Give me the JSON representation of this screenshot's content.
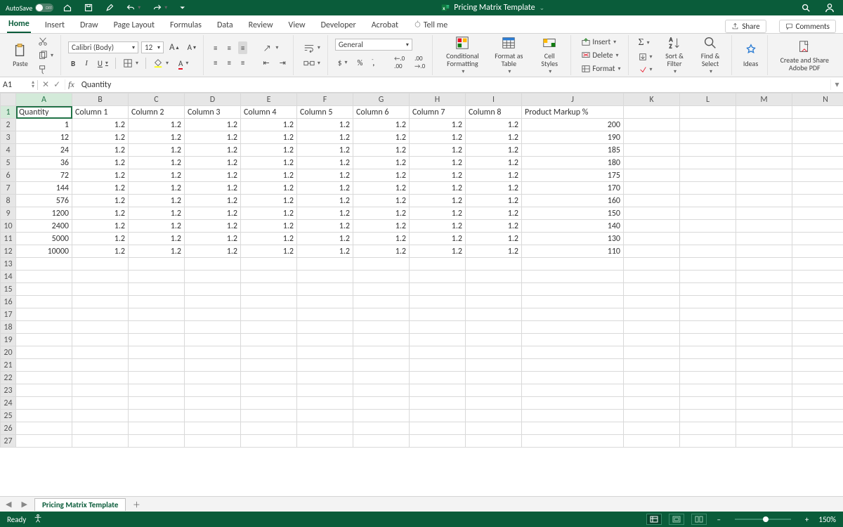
{
  "titlebar": {
    "autosave_label": "AutoSave",
    "document_title": "Pricing Matrix Template"
  },
  "tabs": {
    "items": [
      "Home",
      "Insert",
      "Draw",
      "Page Layout",
      "Formulas",
      "Data",
      "Review",
      "View",
      "Developer",
      "Acrobat"
    ],
    "tellme": "Tell me",
    "share": "Share",
    "comments": "Comments",
    "active": "Home"
  },
  "ribbon": {
    "paste": "Paste",
    "font_name": "Calibri (Body)",
    "font_size": "12",
    "number_format": "General",
    "cond_fmt": "Conditional Formatting",
    "fmt_table": "Format as Table",
    "cell_styles": "Cell Styles",
    "insert": "Insert",
    "delete": "Delete",
    "format": "Format",
    "sort_filter": "Sort & Filter",
    "find_select": "Find & Select",
    "ideas": "Ideas",
    "adobe": "Create and Share Adobe PDF"
  },
  "formula_bar": {
    "cell_ref": "A1",
    "formula": "Quantity"
  },
  "grid": {
    "columns": [
      "A",
      "B",
      "C",
      "D",
      "E",
      "F",
      "G",
      "H",
      "I",
      "J",
      "K",
      "L",
      "M",
      "N"
    ],
    "header_row": [
      "Quantity",
      "Column 1",
      "Column 2",
      "Column 3",
      "Column 4",
      "Column 5",
      "Column 6",
      "Column 7",
      "Column 8",
      "Product Markup %",
      "",
      "",
      "",
      ""
    ],
    "data_rows": [
      [
        "1",
        "1.2",
        "1.2",
        "1.2",
        "1.2",
        "1.2",
        "1.2",
        "1.2",
        "1.2",
        "200",
        "",
        "",
        "",
        ""
      ],
      [
        "12",
        "1.2",
        "1.2",
        "1.2",
        "1.2",
        "1.2",
        "1.2",
        "1.2",
        "1.2",
        "190",
        "",
        "",
        "",
        ""
      ],
      [
        "24",
        "1.2",
        "1.2",
        "1.2",
        "1.2",
        "1.2",
        "1.2",
        "1.2",
        "1.2",
        "185",
        "",
        "",
        "",
        ""
      ],
      [
        "36",
        "1.2",
        "1.2",
        "1.2",
        "1.2",
        "1.2",
        "1.2",
        "1.2",
        "1.2",
        "180",
        "",
        "",
        "",
        ""
      ],
      [
        "72",
        "1.2",
        "1.2",
        "1.2",
        "1.2",
        "1.2",
        "1.2",
        "1.2",
        "1.2",
        "175",
        "",
        "",
        "",
        ""
      ],
      [
        "144",
        "1.2",
        "1.2",
        "1.2",
        "1.2",
        "1.2",
        "1.2",
        "1.2",
        "1.2",
        "170",
        "",
        "",
        "",
        ""
      ],
      [
        "576",
        "1.2",
        "1.2",
        "1.2",
        "1.2",
        "1.2",
        "1.2",
        "1.2",
        "1.2",
        "160",
        "",
        "",
        "",
        ""
      ],
      [
        "1200",
        "1.2",
        "1.2",
        "1.2",
        "1.2",
        "1.2",
        "1.2",
        "1.2",
        "1.2",
        "150",
        "",
        "",
        "",
        ""
      ],
      [
        "2400",
        "1.2",
        "1.2",
        "1.2",
        "1.2",
        "1.2",
        "1.2",
        "1.2",
        "1.2",
        "140",
        "",
        "",
        "",
        ""
      ],
      [
        "5000",
        "1.2",
        "1.2",
        "1.2",
        "1.2",
        "1.2",
        "1.2",
        "1.2",
        "1.2",
        "130",
        "",
        "",
        "",
        ""
      ],
      [
        "10000",
        "1.2",
        "1.2",
        "1.2",
        "1.2",
        "1.2",
        "1.2",
        "1.2",
        "1.2",
        "110",
        "",
        "",
        "",
        ""
      ]
    ],
    "empty_rows_after": 15,
    "active_cell": "A1"
  },
  "sheet_tabs": {
    "active": "Pricing Matrix Template"
  },
  "status": {
    "ready": "Ready",
    "zoom": "150%"
  }
}
